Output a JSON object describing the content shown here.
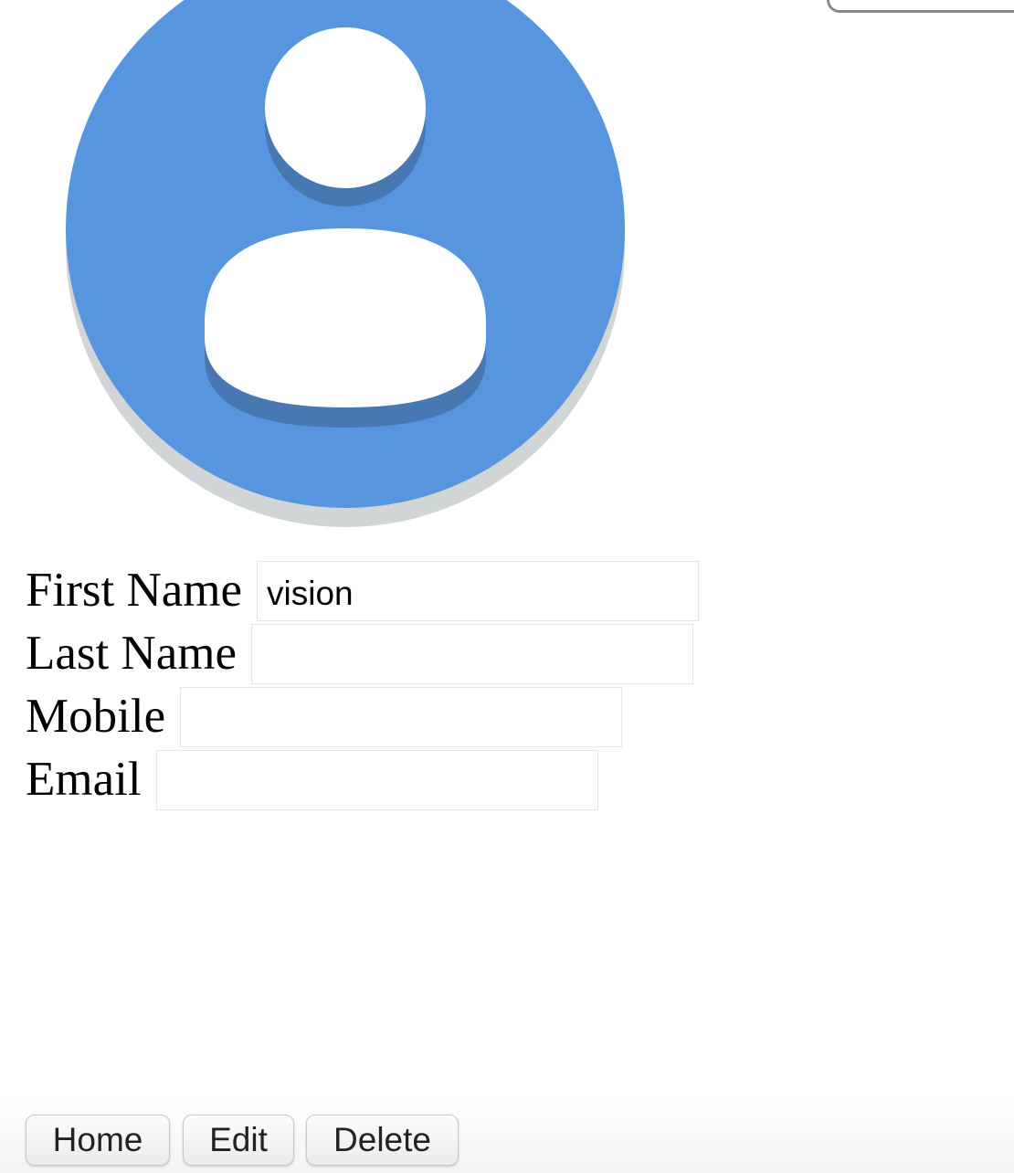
{
  "form": {
    "first_name": {
      "label": "First Name",
      "value": "vision"
    },
    "last_name": {
      "label": "Last Name",
      "value": ""
    },
    "mobile": {
      "label": "Mobile",
      "value": ""
    },
    "email": {
      "label": "Email",
      "value": ""
    }
  },
  "toolbar": {
    "home_label": "Home",
    "edit_label": "Edit",
    "delete_label": "Delete"
  },
  "avatar": {
    "icon": "user-profile-icon",
    "circle_color": "#5795df",
    "shadow_color": "#4878b2",
    "rim_color": "#d2d5d6"
  }
}
